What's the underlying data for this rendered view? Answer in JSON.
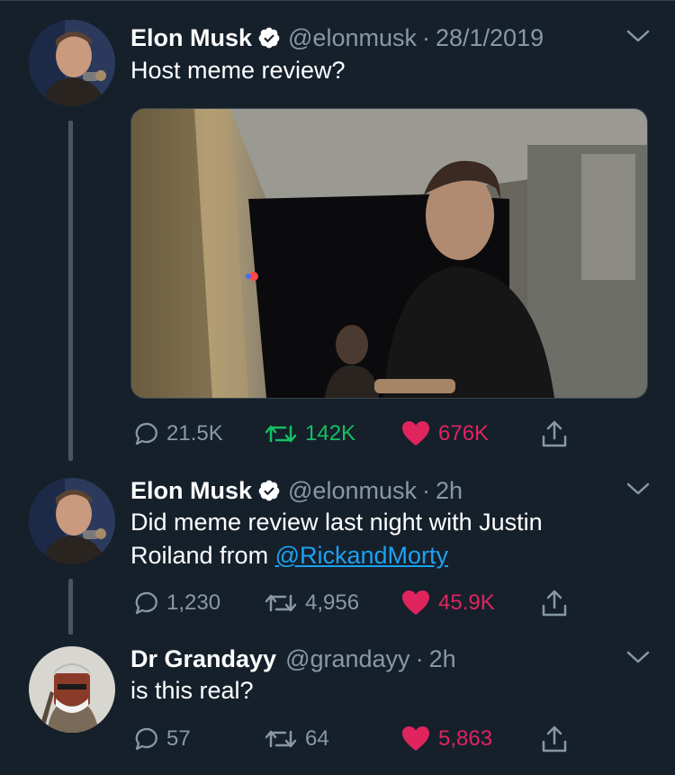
{
  "tweets": [
    {
      "name": "Elon Musk",
      "handle": "@elonmusk",
      "time": "28/1/2019",
      "text": "Host meme review?",
      "replies": "21.5K",
      "retweets": "142K",
      "likes": "676K",
      "avatar_icon": "elon-musk-avatar",
      "has_media": true
    },
    {
      "name": "Elon Musk",
      "handle": "@elonmusk",
      "time": "2h",
      "text_line1": "Did meme review last night with Justin",
      "text_line2_prefix": "Roiland from ",
      "text_link": "@RickandMorty",
      "replies": "1,230",
      "retweets": "4,956",
      "likes": "45.9K",
      "avatar_icon": "elon-musk-avatar"
    },
    {
      "name": "Dr Grandayy",
      "handle": "@grandayy",
      "time": "2h",
      "text": "is this real?",
      "replies": "57",
      "retweets": "64",
      "likes": "5,863",
      "avatar_icon": "grandayy-avatar"
    }
  ],
  "separator": "·",
  "colors": {
    "background": "#15202b",
    "secondary_text": "#8899a6",
    "link": "#1da1f2",
    "retweet_active": "#17bf63",
    "like_active": "#e0245e",
    "verified": "#ffffff"
  }
}
